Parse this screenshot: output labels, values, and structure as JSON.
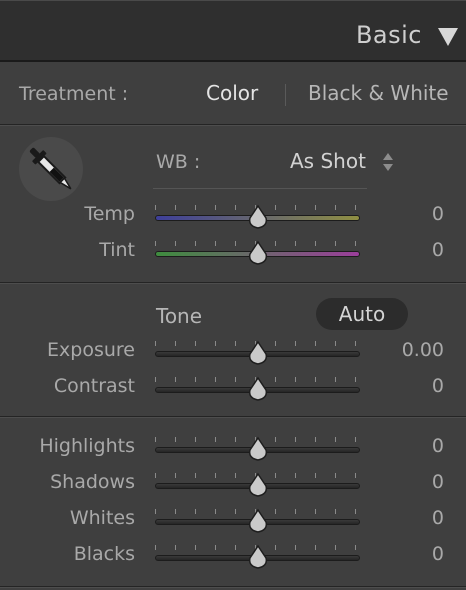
{
  "header": {
    "title": "Basic",
    "collapse_icon": "triangle-down-icon"
  },
  "treatment": {
    "label": "Treatment :",
    "options": [
      "Color",
      "Black & White"
    ],
    "selected": "Color"
  },
  "white_balance": {
    "tool_icon": "eyedropper-icon",
    "label": "WB :",
    "value": "As Shot",
    "stepper_icon": "up-down-stepper-icon"
  },
  "wb_sliders": [
    {
      "id": "temp",
      "label": "Temp",
      "value": "0",
      "position": 0.5,
      "gradient": [
        "#3e3f9a",
        "#8f8f42"
      ]
    },
    {
      "id": "tint",
      "label": "Tint",
      "value": "0",
      "position": 0.5,
      "gradient": [
        "#3e8c3e",
        "#9b3e9b"
      ]
    }
  ],
  "tone": {
    "label": "Tone",
    "auto_label": "Auto"
  },
  "tone_sliders": [
    {
      "id": "exposure",
      "label": "Exposure",
      "value": "0.00",
      "position": 0.5
    },
    {
      "id": "contrast",
      "label": "Contrast",
      "value": "0",
      "position": 0.5
    }
  ],
  "presence_sliders": [
    {
      "id": "highlights",
      "label": "Highlights",
      "value": "0",
      "position": 0.5
    },
    {
      "id": "shadows",
      "label": "Shadows",
      "value": "0",
      "position": 0.5
    },
    {
      "id": "whites",
      "label": "Whites",
      "value": "0",
      "position": 0.5
    },
    {
      "id": "blacks",
      "label": "Blacks",
      "value": "0",
      "position": 0.5
    }
  ]
}
